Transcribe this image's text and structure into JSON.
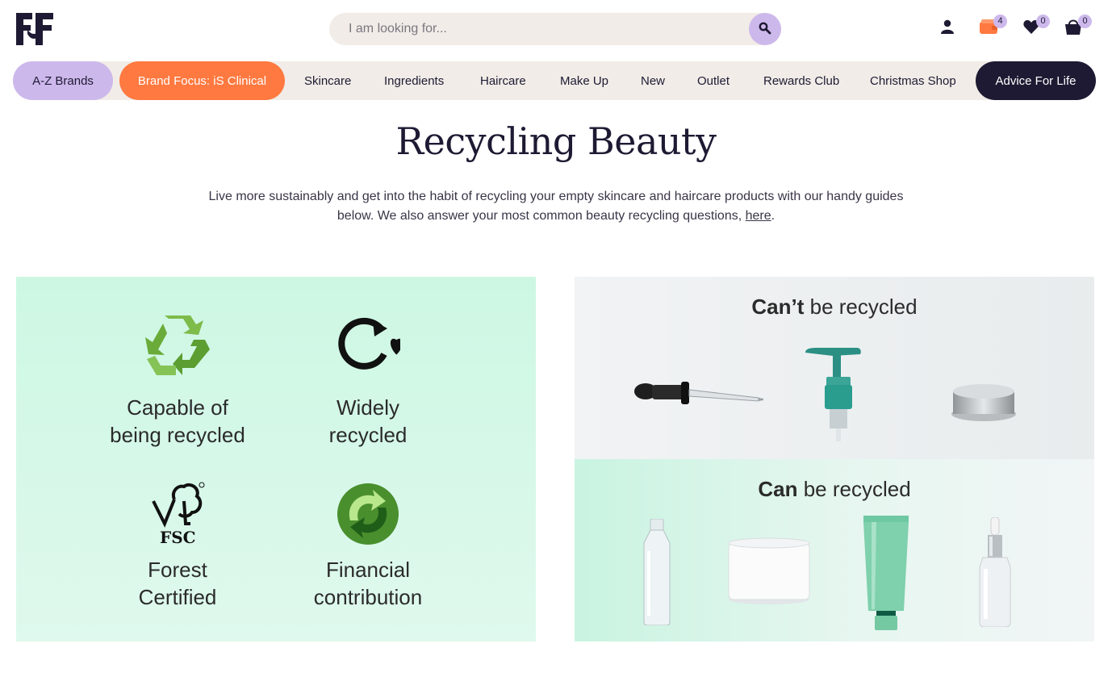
{
  "header": {
    "logo_alt": "FF",
    "search": {
      "placeholder": "I am looking for..."
    },
    "basket_badge": "4",
    "wishlist_badge": "0",
    "cart_badge": "0",
    "icons": [
      "account-icon",
      "wallet-icon",
      "heart-icon",
      "basket-icon",
      "search-icon"
    ]
  },
  "nav": {
    "items": [
      "A-Z Brands",
      "Brand Focus: iS Clinical",
      "Skincare",
      "Ingredients",
      "Haircare",
      "Make Up",
      "New",
      "Outlet",
      "Rewards Club",
      "Christmas Shop",
      "Advice For Life"
    ]
  },
  "page": {
    "title": "Recycling Beauty",
    "intro_text": "Live more sustainably and get into the habit of recycling your empty skincare and haircare products with our handy guides below. We also answer your most common beauty recycling questions, ",
    "intro_link": "here",
    "intro_end": "."
  },
  "symbols": {
    "items": [
      {
        "line1": "Capable of",
        "line2": "being recycled",
        "icon": "recycle-icon"
      },
      {
        "line1": "Widely",
        "line2": "recycled",
        "icon": "widely-recycled-icon"
      },
      {
        "line1": "Forest",
        "line2": "Certified",
        "icon": "fsc-icon",
        "logo_text": "FSC"
      },
      {
        "line1": "Financial",
        "line2": "contribution",
        "icon": "green-dot-icon"
      }
    ]
  },
  "recycle_guide": {
    "cant_bold": "Can’t",
    "cant_rest": " be recycled",
    "can_bold": "Can",
    "can_rest": " be recycled"
  },
  "colors": {
    "primary_dark": "#1e1a33",
    "lavender": "#cdb8ec",
    "orange": "#ff7940",
    "beige": "#f1ece7",
    "mint": "#cdf7e3"
  }
}
